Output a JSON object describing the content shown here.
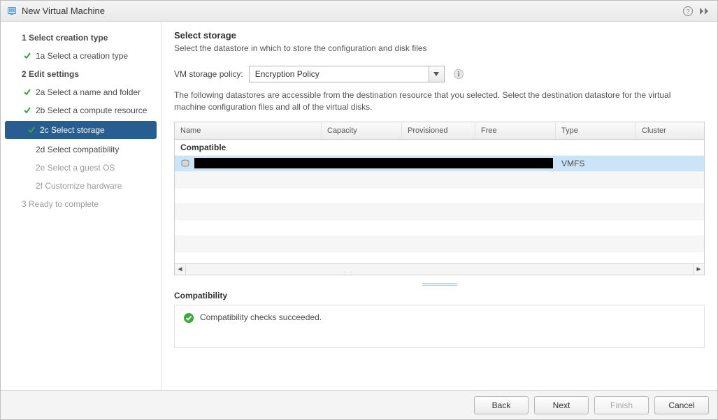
{
  "dialog": {
    "title": "New Virtual Machine"
  },
  "sidebar": {
    "steps": [
      {
        "id": "1",
        "label": "1  Select creation type"
      },
      {
        "id": "1a",
        "label": "1a  Select a creation type"
      },
      {
        "id": "2",
        "label": "2  Edit settings"
      },
      {
        "id": "2a",
        "label": "2a  Select a name and folder"
      },
      {
        "id": "2b",
        "label": "2b  Select a compute resource"
      },
      {
        "id": "2c",
        "label": "2c  Select storage"
      },
      {
        "id": "2d",
        "label": "2d  Select compatibility"
      },
      {
        "id": "2e",
        "label": "2e  Select a guest OS"
      },
      {
        "id": "2f",
        "label": "2f  Customize hardware"
      },
      {
        "id": "3",
        "label": "3  Ready to complete"
      }
    ]
  },
  "panel": {
    "title": "Select storage",
    "subtitle": "Select the datastore in which to store the configuration and disk files",
    "policy_label": "VM storage policy:",
    "policy_value": "Encryption Policy",
    "description": "The following datastores are accessible from the destination resource that you selected. Select the destination datastore for the virtual machine configuration files and all of the virtual disks."
  },
  "table": {
    "columns": {
      "name": "Name",
      "capacity": "Capacity",
      "provisioned": "Provisioned",
      "free": "Free",
      "type": "Type",
      "cluster": "Cluster"
    },
    "compatible_header": "Compatible",
    "rows": [
      {
        "name": "",
        "capacity": "",
        "provisioned": "",
        "free": "",
        "type": "VMFS",
        "cluster": ""
      }
    ]
  },
  "compatibility": {
    "title": "Compatibility",
    "message": "Compatibility checks succeeded."
  },
  "buttons": {
    "back": "Back",
    "next": "Next",
    "finish": "Finish",
    "cancel": "Cancel"
  }
}
